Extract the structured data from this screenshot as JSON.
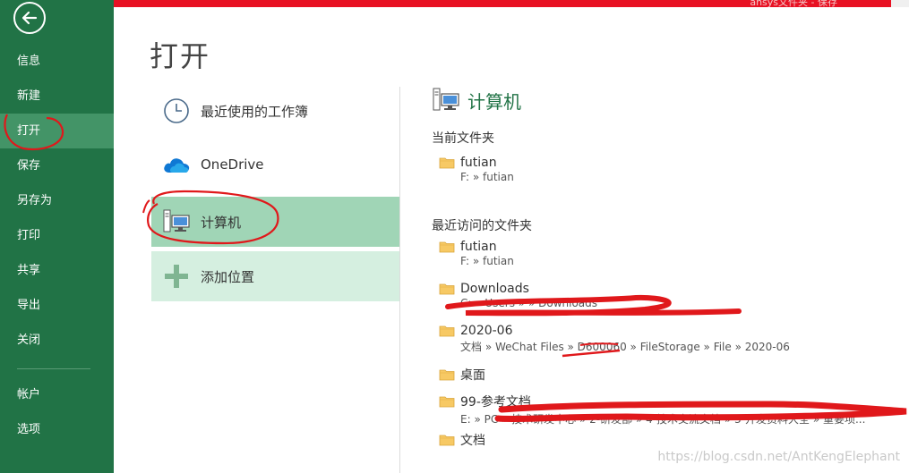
{
  "window": {
    "title": "ansys文件夹 - 保存",
    "accent_color": "#217346",
    "titlebar_color": "#e81123"
  },
  "sidebar": {
    "back_icon": "back-arrow-icon",
    "items": [
      {
        "label": "信息"
      },
      {
        "label": "新建"
      },
      {
        "label": "打开"
      },
      {
        "label": "保存"
      },
      {
        "label": "另存为"
      },
      {
        "label": "打印"
      },
      {
        "label": "共享"
      },
      {
        "label": "导出"
      },
      {
        "label": "关闭"
      },
      {
        "label": "帐户"
      },
      {
        "label": "选项"
      }
    ],
    "active_item": "打开"
  },
  "main": {
    "title": "打开",
    "locations": [
      {
        "label": "最近使用的工作簿",
        "icon": "clock-icon"
      },
      {
        "label": "OneDrive",
        "icon": "onedrive-cloud-icon"
      },
      {
        "label": "计算机",
        "icon": "computer-icon"
      },
      {
        "label": "添加位置",
        "icon": "plus-icon"
      }
    ],
    "selected_location": "计算机"
  },
  "right": {
    "title": "计算机",
    "current_section": "当前文件夹",
    "current_folder": {
      "name": "futian",
      "path": "F: » futian"
    },
    "recent_section": "最近访问的文件夹",
    "recent_folders": [
      {
        "name": "futian",
        "path": "F: » futian"
      },
      {
        "name": "Downloads",
        "path": "C: » Users » » Downloads"
      },
      {
        "name": "2020-06",
        "path": "文档 » WeChat Files » D600060 » FileStorage » File » 2020-06"
      },
      {
        "name": "桌面",
        "path": ""
      },
      {
        "name": "99-参考文档",
        "path": "E: » PC » 技术研发中心 » 2-研发部 » 4-技术交流文档 » 3-开发资料大全 » 重要项..."
      },
      {
        "name": "文档",
        "path": ""
      }
    ]
  },
  "watermark": "https://blog.csdn.net/AntKengElephant"
}
